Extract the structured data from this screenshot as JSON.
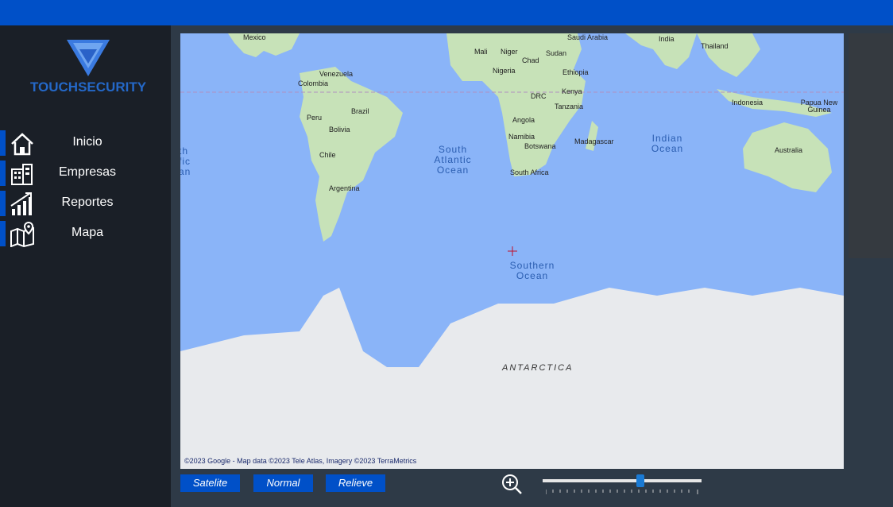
{
  "brand": {
    "name": "TOUCHSECURITY",
    "logo_icon": "shield-v-logo"
  },
  "nav": {
    "items": [
      {
        "label": "Inicio",
        "icon": "home-icon"
      },
      {
        "label": "Empresas",
        "icon": "building-icon"
      },
      {
        "label": "Reportes",
        "icon": "chart-growth-icon"
      },
      {
        "label": "Mapa",
        "icon": "map-pin-icon"
      }
    ]
  },
  "map": {
    "labels": {
      "mexico": "Mexico",
      "saudi": "Saudi Arabia",
      "india": "India",
      "thailand": "Thailand",
      "mali": "Mali",
      "niger": "Niger",
      "sudan": "Sudan",
      "chad": "Chad",
      "venezuela": "Venezuela",
      "colombia": "Colombia",
      "nigeria": "Nigeria",
      "ethiopia": "Ethiopia",
      "brazil": "Brazil",
      "drc": "DRC",
      "peru": "Peru",
      "kenya": "Kenya",
      "tanzania": "Tanzania",
      "indonesia": "Indonesia",
      "png": "Papua New Guinea",
      "bolivia": "Bolivia",
      "angola": "Angola",
      "namibia": "Namibia",
      "madagascar": "Madagascar",
      "botswana": "Botswana",
      "australia": "Australia",
      "chile": "Chile",
      "south_africa": "South Africa",
      "argentina": "Argentina",
      "antarctica": "ANTARCTICA"
    },
    "oceans": {
      "south_atlantic": "South Atlantic Ocean",
      "indian": "Indian Ocean",
      "southern": "Southern Ocean",
      "edge": "th fic an"
    },
    "copyright": "©2023 Google - Map data ©2023 Tele Atlas, Imagery ©2023 TerraMetrics"
  },
  "map_controls": {
    "buttons": [
      "Satelite",
      "Normal",
      "Relieve"
    ],
    "zoom_icon": "zoom-in-icon",
    "zoom_level": 0.62
  },
  "colors": {
    "accent": "#0050c8",
    "sidebar_bg": "#1a1f27",
    "main_bg": "#2e3a47",
    "water": "#8ab4f8",
    "land": "#c7e2b8",
    "ice": "#e8eaed"
  }
}
